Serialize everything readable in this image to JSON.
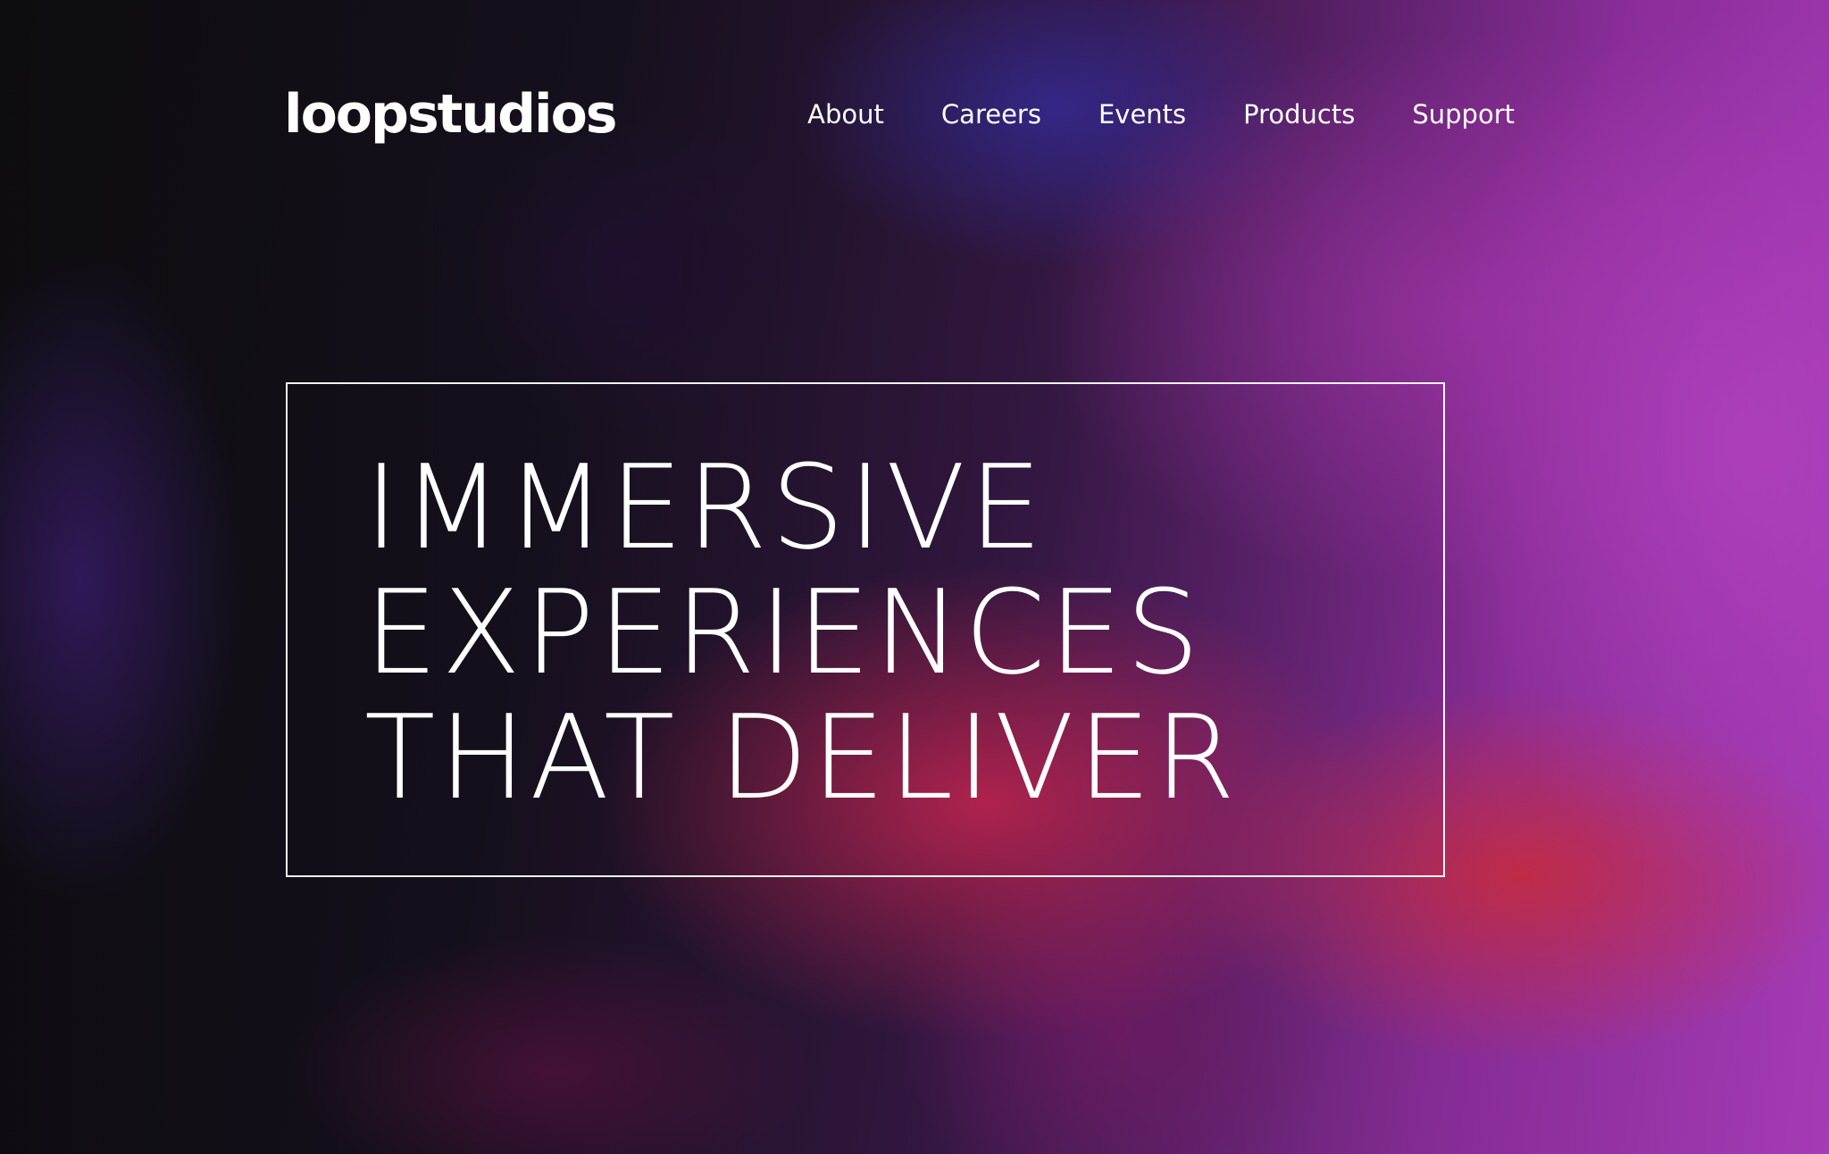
{
  "brand": {
    "logo": "loopstudios"
  },
  "nav": {
    "items": [
      {
        "label": "About"
      },
      {
        "label": "Careers"
      },
      {
        "label": "Events"
      },
      {
        "label": "Products"
      },
      {
        "label": "Support"
      }
    ]
  },
  "hero": {
    "headline_lines": [
      "IMMERSIVE",
      "EXPERIENCES",
      "THAT DELIVER"
    ]
  }
}
